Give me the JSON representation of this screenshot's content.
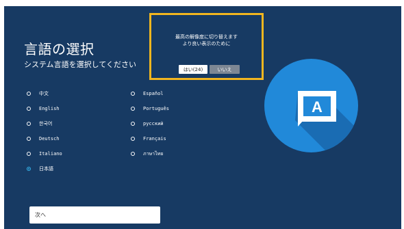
{
  "title": "言語の選択",
  "subtitle": "システム言語を選択してください",
  "languages": [
    {
      "label": "中文",
      "selected": false
    },
    {
      "label": "English",
      "selected": false
    },
    {
      "label": "한국어",
      "selected": false
    },
    {
      "label": "Deutsch",
      "selected": false
    },
    {
      "label": "Italiano",
      "selected": false
    },
    {
      "label": "日本語",
      "selected": true
    },
    {
      "label": "Español",
      "selected": false
    },
    {
      "label": "Português",
      "selected": false
    },
    {
      "label": "русский",
      "selected": false
    },
    {
      "label": "Français",
      "selected": false
    },
    {
      "label": "ภาษาไทย",
      "selected": false
    }
  ],
  "next_button": "次へ",
  "dialog": {
    "line1": "最高の解像度に切り替えます",
    "line2": "より良い表示のために",
    "yes_label": "はい(24)",
    "no_label": "いいえ"
  },
  "graphic": {
    "glyph": "A",
    "icon": "language-icon"
  },
  "colors": {
    "background": "#173a63",
    "accent": "#35b6ee",
    "dialog_border": "#f2b61f",
    "circle": "#2189d9"
  }
}
